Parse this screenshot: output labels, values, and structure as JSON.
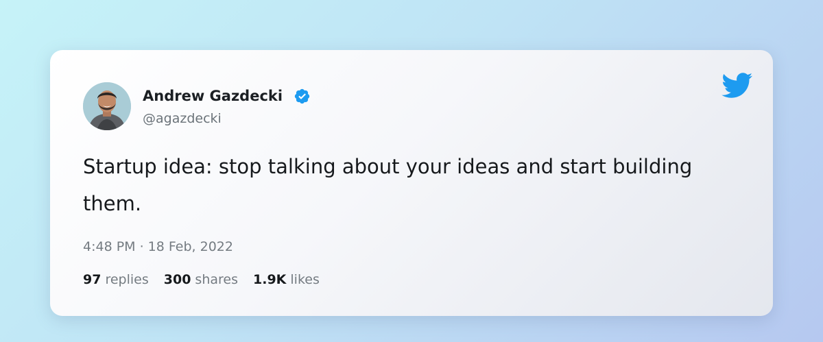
{
  "tweet": {
    "author": {
      "name": "Andrew Gazdecki",
      "handle": "@agazdecki",
      "verified": true
    },
    "text": "Startup idea: stop talking about your ideas and start building them.",
    "timestamp": "4:48 PM · 18 Feb, 2022",
    "stats": {
      "replies": {
        "count": "97",
        "label": "replies"
      },
      "shares": {
        "count": "300",
        "label": "shares"
      },
      "likes": {
        "count": "1.9K",
        "label": "likes"
      }
    }
  },
  "icons": {
    "brand": "twitter-bird-icon",
    "verified": "verified-badge-icon"
  },
  "colors": {
    "twitter_blue": "#1d9bf0",
    "text_primary": "#16191c",
    "text_secondary": "#747b81"
  }
}
